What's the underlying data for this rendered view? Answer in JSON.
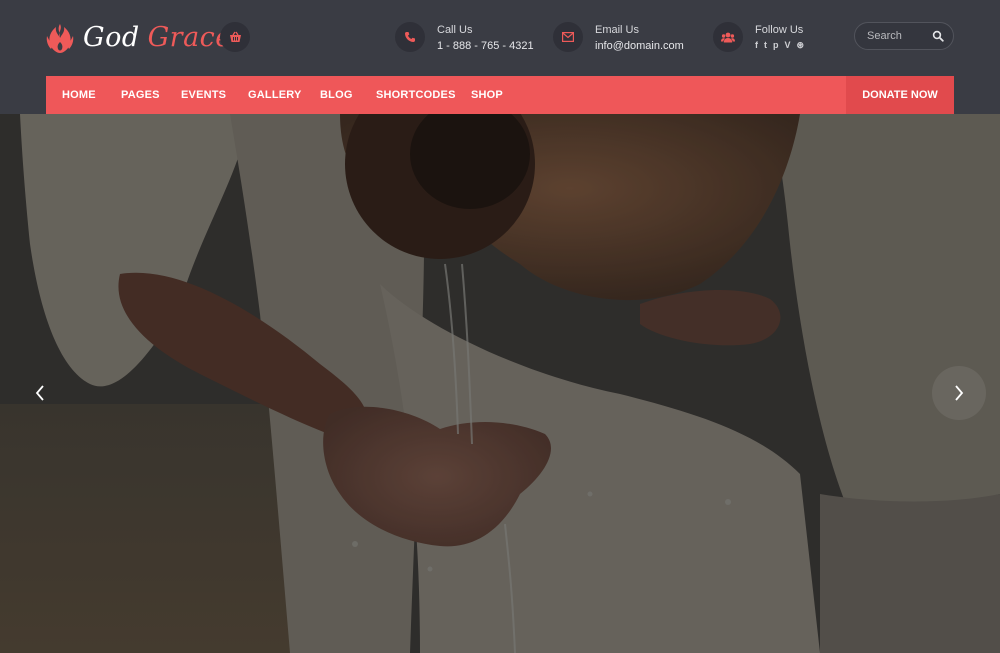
{
  "brand": {
    "word1": "God",
    "word2": "Grace",
    "accent": "#ef5759"
  },
  "header": {
    "cart_icon": "shopping-basket-icon",
    "call": {
      "label": "Call Us",
      "value": "1 - 888 - 765 - 4321",
      "icon": "phone-icon"
    },
    "email": {
      "label": "Email Us",
      "value": "info@domain.com",
      "icon": "envelope-icon"
    },
    "follow": {
      "label": "Follow Us",
      "icon": "users-icon",
      "networks": [
        {
          "name": "facebook-icon",
          "glyph": "f"
        },
        {
          "name": "twitter-icon",
          "glyph": "t"
        },
        {
          "name": "pinterest-icon",
          "glyph": "p"
        },
        {
          "name": "vimeo-icon",
          "glyph": "V"
        },
        {
          "name": "dribbble-icon",
          "glyph": "⊛"
        }
      ]
    },
    "search": {
      "placeholder": "Search",
      "icon": "search-icon"
    }
  },
  "nav": {
    "items": [
      "Home",
      "Pages",
      "Events",
      "Gallery",
      "Blog",
      "Shortcodes",
      "Shop"
    ],
    "donate": "Donate Now"
  },
  "slider": {
    "prev_icon": "chevron-left-icon",
    "next_icon": "chevron-right-icon"
  }
}
